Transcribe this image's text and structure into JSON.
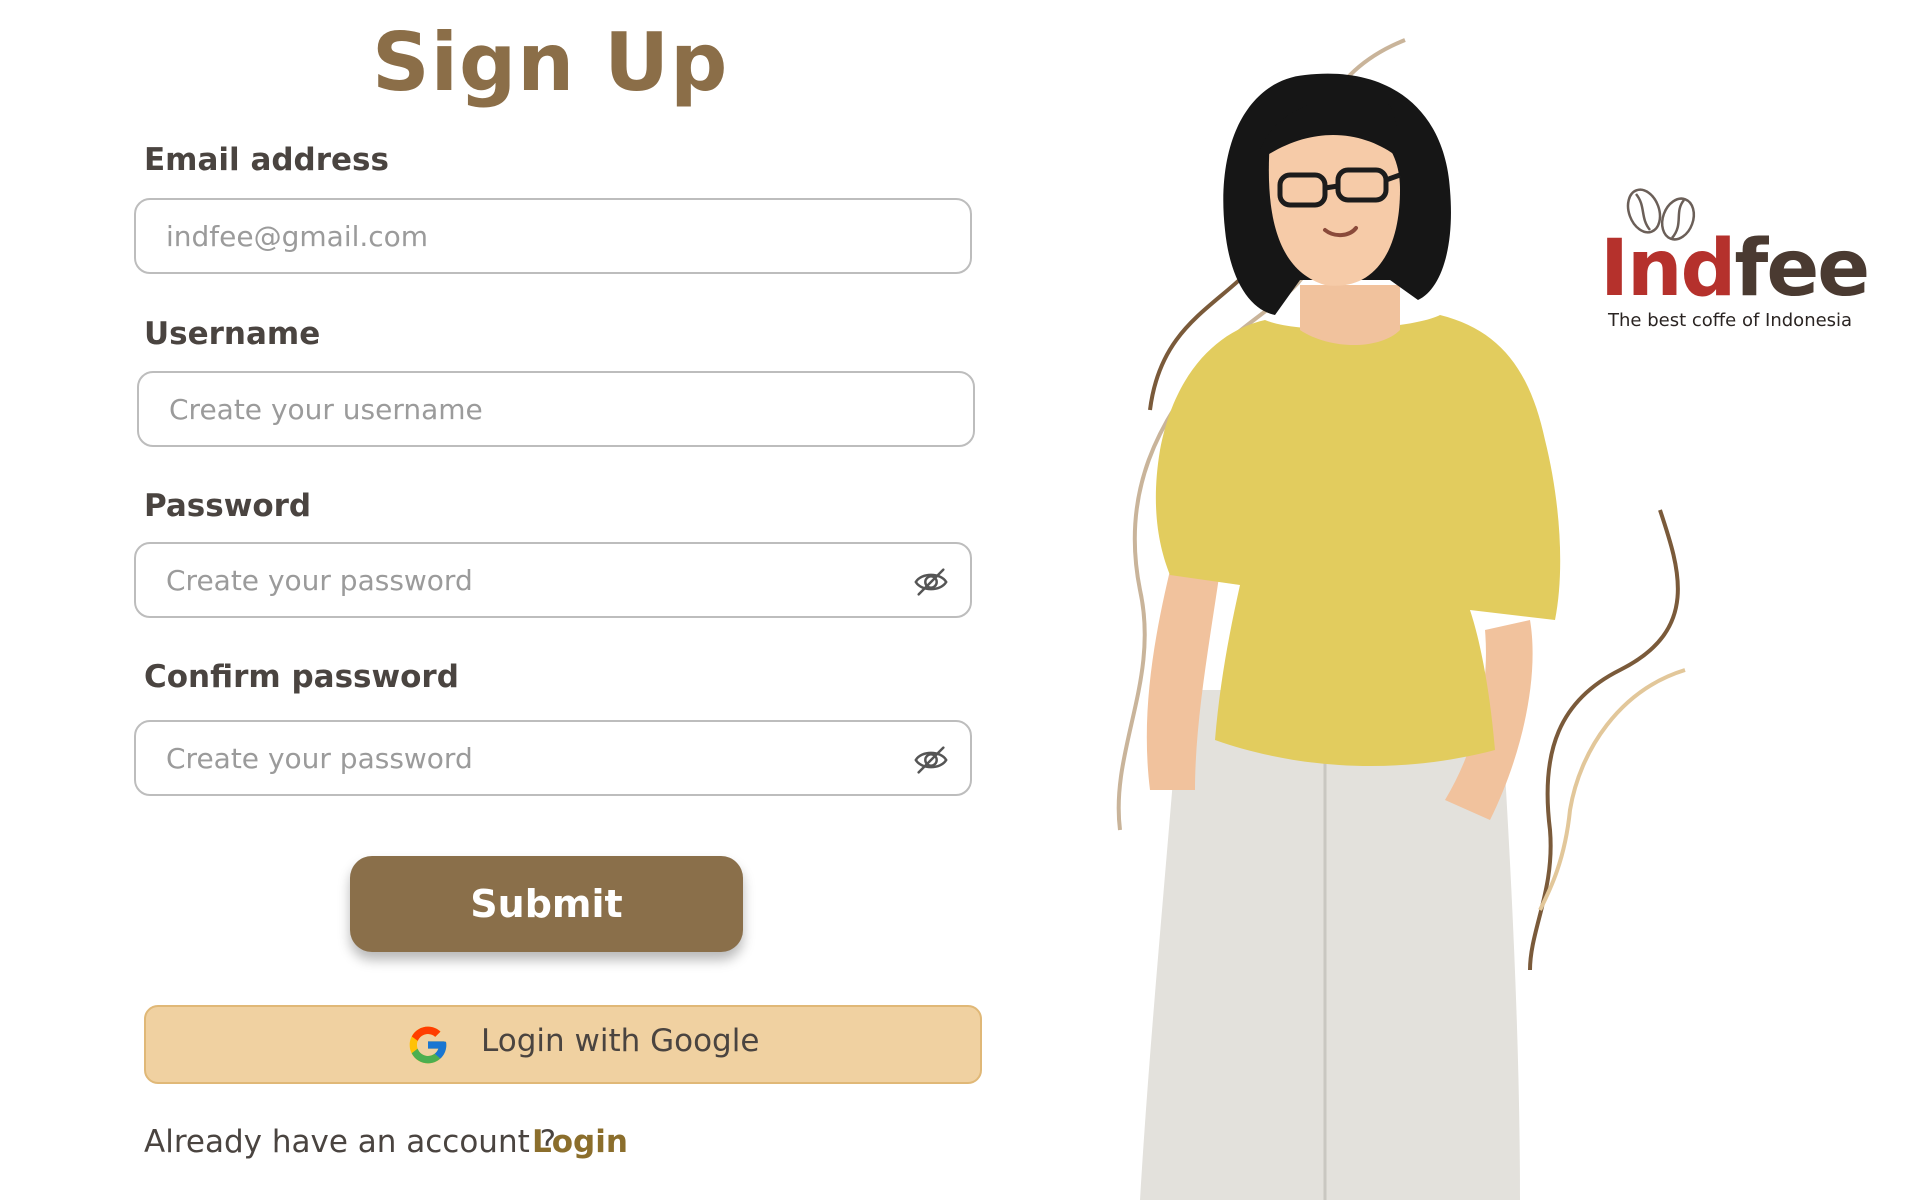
{
  "page": {
    "title": "Sign Up"
  },
  "form": {
    "email": {
      "label": "Email address",
      "placeholder": "indfee@gmail.com",
      "value": ""
    },
    "username": {
      "label": "Username",
      "placeholder": "Create your username",
      "value": ""
    },
    "password": {
      "label": "Password",
      "placeholder": "Create your password",
      "value": ""
    },
    "confirm_password": {
      "label": "Confirm password",
      "placeholder": "Create your password",
      "value": ""
    },
    "submit_label": "Submit",
    "google_label": "Login with Google",
    "already_text": "Already have an account ?",
    "login_link": "Login"
  },
  "brand": {
    "name_part1": "Ind",
    "name_part2": "fee",
    "tagline": "The best coffe of Indonesia",
    "colors": {
      "red": "#b5312c",
      "dark": "#4a3a31",
      "accent": "#8a6f4a",
      "google_bg": "#f0d1a1"
    }
  },
  "icons": {
    "password_toggle": "eye-slash-icon",
    "google": "google-icon",
    "logo_beans": "coffee-beans-icon"
  }
}
